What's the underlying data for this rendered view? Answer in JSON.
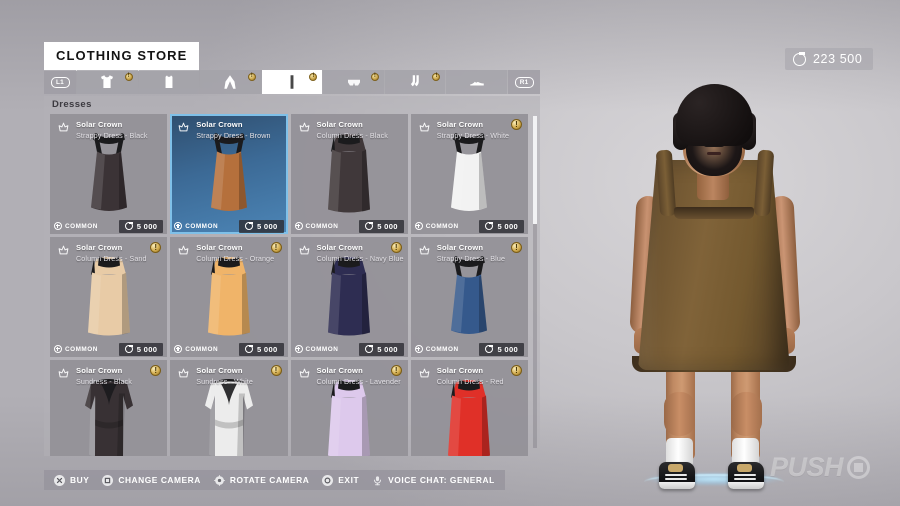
{
  "window": {
    "title": "CLOTHING STORE"
  },
  "hud": {
    "currency_icon": "coin-icon",
    "currency_value": "223 500",
    "watermark_text": "PUSH",
    "watermark_icon": "square-in-circle-icon"
  },
  "tabs": {
    "left_bumper": "L1",
    "right_bumper": "R1",
    "items": [
      {
        "icon": "tshirt-icon",
        "label": "Tops",
        "badge": "!",
        "active": false
      },
      {
        "icon": "tanktop-icon",
        "label": "Tank Tops",
        "badge": "",
        "active": false
      },
      {
        "icon": "pants-icon",
        "label": "Pants",
        "badge": "!",
        "active": false
      },
      {
        "icon": "dress-icon",
        "label": "Dresses",
        "badge": "!",
        "active": true
      },
      {
        "icon": "shorts-icon",
        "label": "Shorts",
        "badge": "!",
        "active": false
      },
      {
        "icon": "socks-icon",
        "label": "Socks",
        "badge": "!",
        "active": false
      },
      {
        "icon": "shoes-icon",
        "label": "Shoes",
        "badge": "",
        "active": false
      }
    ]
  },
  "panel": {
    "section_title": "Dresses",
    "scroll_position_percent": 0,
    "items": [
      {
        "brand": "Solar Crown",
        "variant": "Strappy Dress - Black",
        "rarity": "COMMON",
        "price": "5 000",
        "badge": "",
        "selected": false,
        "color": "#3b3336",
        "type": "strappy"
      },
      {
        "brand": "Solar Crown",
        "variant": "Strappy Dress - Brown",
        "rarity": "COMMON",
        "price": "5 000",
        "badge": "",
        "selected": true,
        "color": "#b5703c",
        "type": "strappy"
      },
      {
        "brand": "Solar Crown",
        "variant": "Column Dress - Black",
        "rarity": "COMMON",
        "price": "5 000",
        "badge": "",
        "selected": false,
        "color": "#40383a",
        "type": "column"
      },
      {
        "brand": "Solar Crown",
        "variant": "Strappy Dress - White",
        "rarity": "COMMON",
        "price": "5 000",
        "badge": "!",
        "selected": false,
        "color": "#f2f2f2",
        "type": "strappy"
      },
      {
        "brand": "Solar Crown",
        "variant": "Column Dress - Sand",
        "rarity": "COMMON",
        "price": "5 000",
        "badge": "!",
        "selected": false,
        "color": "#e8cba6",
        "type": "column"
      },
      {
        "brand": "Solar Crown",
        "variant": "Column Dress - Orange",
        "rarity": "COMMON",
        "price": "5 000",
        "badge": "!",
        "selected": false,
        "color": "#f0b469",
        "type": "column"
      },
      {
        "brand": "Solar Crown",
        "variant": "Column Dress - Navy Blue",
        "rarity": "COMMON",
        "price": "5 000",
        "badge": "!",
        "selected": false,
        "color": "#2e2d52",
        "type": "column"
      },
      {
        "brand": "Solar Crown",
        "variant": "Strappy Dress - Blue",
        "rarity": "COMMON",
        "price": "5 000",
        "badge": "!",
        "selected": false,
        "color": "#35598c",
        "type": "strappy"
      },
      {
        "brand": "Solar Crown",
        "variant": "Sundress - Black",
        "rarity": "",
        "price": "",
        "badge": "!",
        "selected": false,
        "color": "#383134",
        "type": "sundress"
      },
      {
        "brand": "Solar Crown",
        "variant": "Sundress - White",
        "rarity": "",
        "price": "",
        "badge": "!",
        "selected": false,
        "color": "#ececec",
        "type": "sundress"
      },
      {
        "brand": "Solar Crown",
        "variant": "Column Dress - Lavender",
        "rarity": "",
        "price": "",
        "badge": "!",
        "selected": false,
        "color": "#ddc9ec",
        "type": "column"
      },
      {
        "brand": "Solar Crown",
        "variant": "Column Dress - Red",
        "rarity": "",
        "price": "",
        "badge": "!",
        "selected": false,
        "color": "#e03028",
        "type": "column"
      }
    ]
  },
  "actions": [
    {
      "button": "cross",
      "label": "BUY"
    },
    {
      "button": "square",
      "label": "CHANGE CAMERA"
    },
    {
      "button": "rstick",
      "label": "ROTATE CAMERA"
    },
    {
      "button": "circle",
      "label": "EXIT"
    },
    {
      "button": "mic",
      "label": "VOICE CHAT: GENERAL"
    }
  ]
}
